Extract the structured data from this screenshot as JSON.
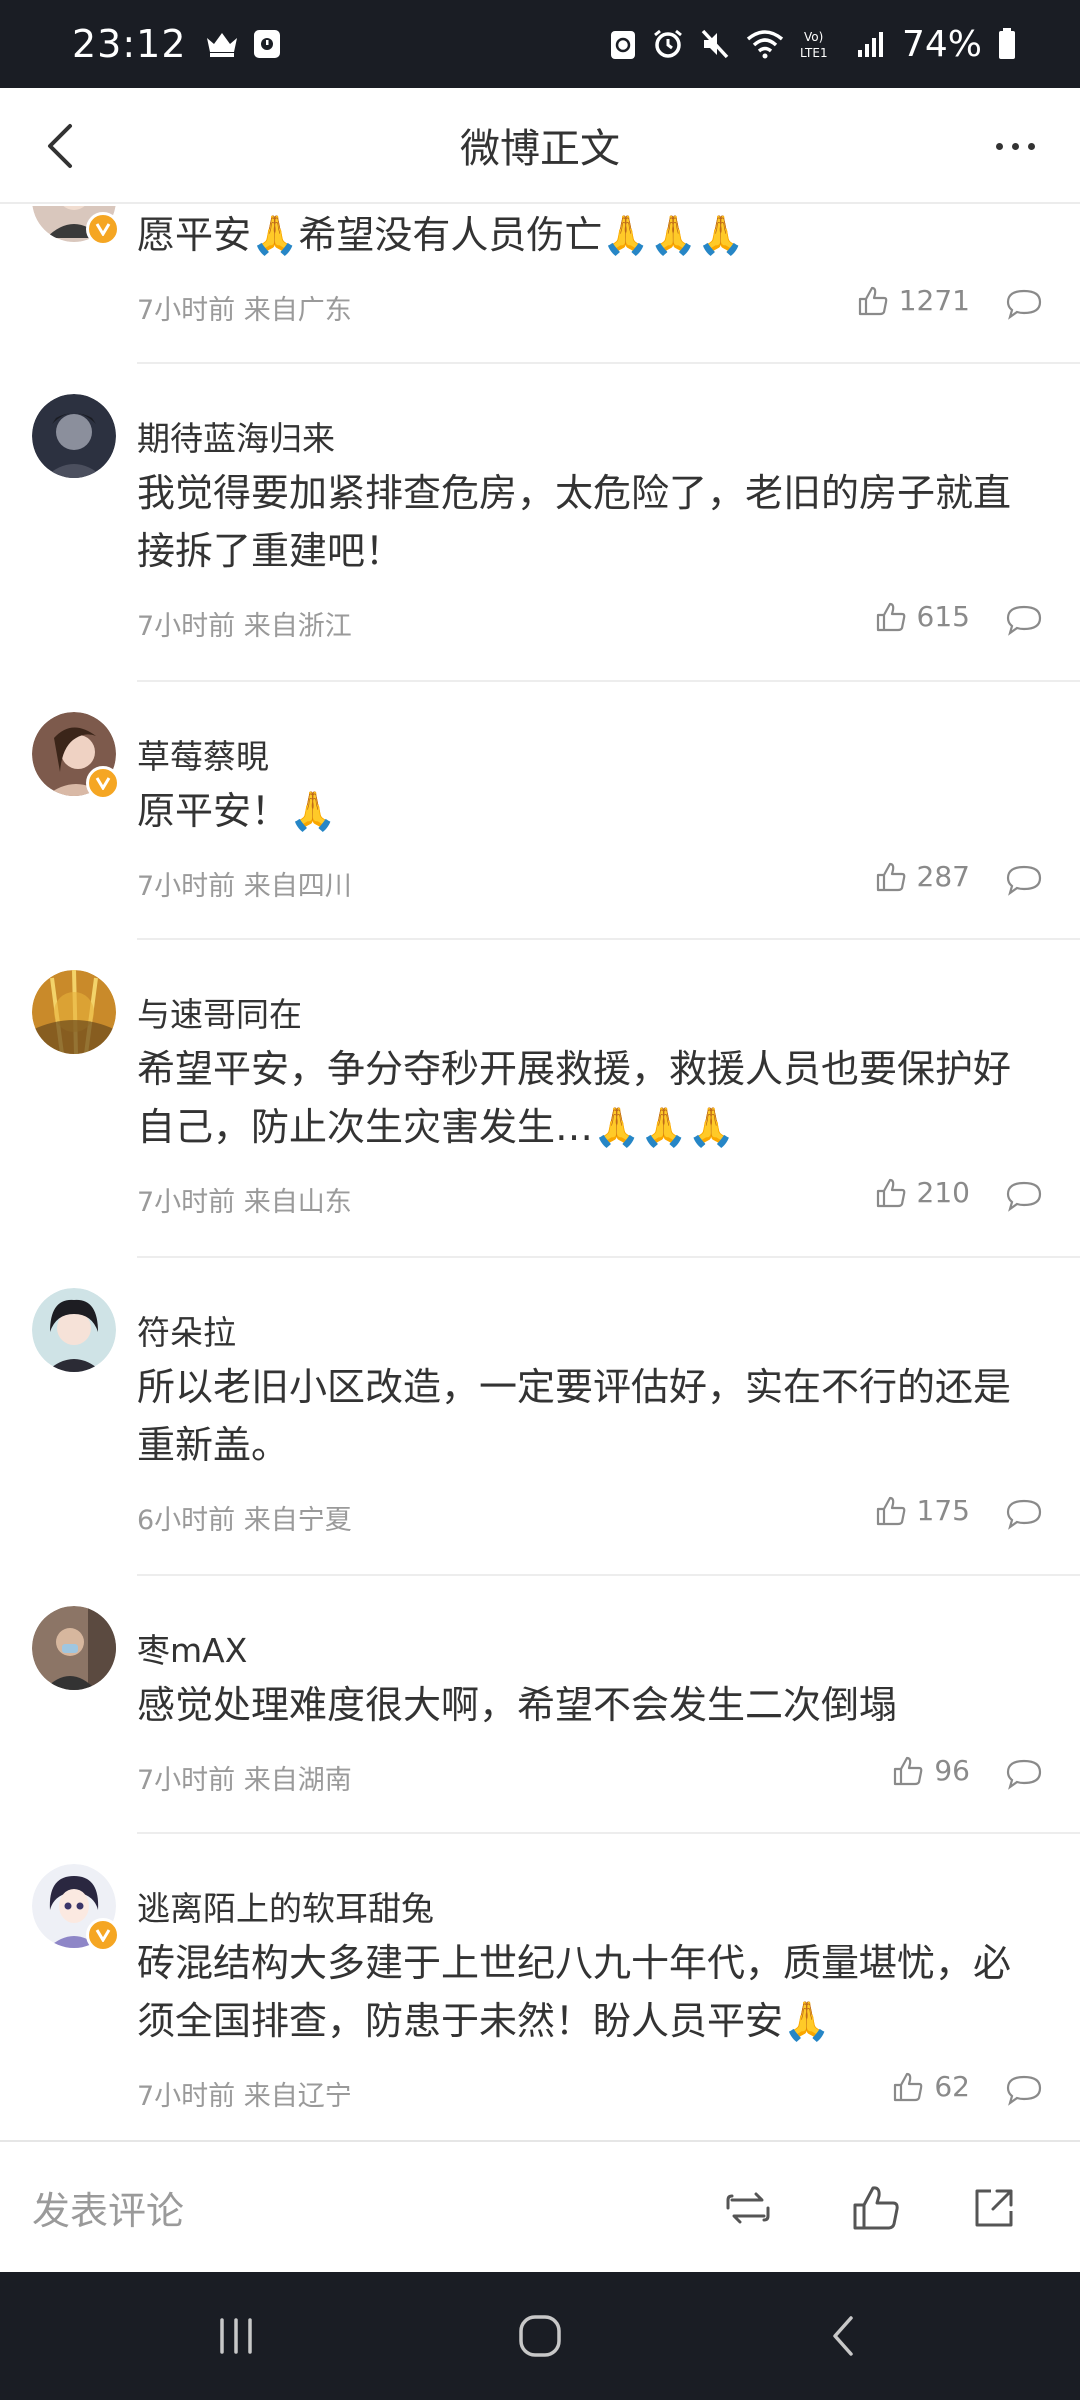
{
  "status_bar": {
    "time": "23:12",
    "battery": "74%"
  },
  "navbar": {
    "title": "微博正文"
  },
  "comments": [
    {
      "username": "",
      "text": "愿平安🙏希望没有人员伤亡🙏🙏🙏",
      "meta": "7小时前 来自广东",
      "likes": "1271",
      "verified": true
    },
    {
      "username": "期待蓝海归来",
      "text": "我觉得要加紧排查危房，太危险了，老旧的房子就直接拆了重建吧！",
      "meta": "7小时前 来自浙江",
      "likes": "615",
      "verified": false
    },
    {
      "username": "草莓蔡晛",
      "text": "原平安！🙏",
      "meta": "7小时前 来自四川",
      "likes": "287",
      "verified": true
    },
    {
      "username": "与速哥同在",
      "text": "希望平安，争分夺秒开展救援，救援人员也要保护好自己，防止次生灾害发生…🙏🙏🙏",
      "meta": "7小时前 来自山东",
      "likes": "210",
      "verified": false
    },
    {
      "username": "符朵拉",
      "text": "所以老旧小区改造，一定要评估好，实在不行的还是重新盖。",
      "meta": "6小时前 来自宁夏",
      "likes": "175",
      "verified": false
    },
    {
      "username": "枣mAX",
      "text": "感觉处理难度很大啊，希望不会发生二次倒塌",
      "meta": "7小时前 来自湖南",
      "likes": "96",
      "verified": false
    },
    {
      "username": "逃离陌上的软耳甜兔",
      "text": "砖混结构大多建于上世纪八九十年代，质量堪忧，必须全国排查，防患于未然！盼人员平安🙏",
      "meta": "7小时前 来自辽宁",
      "likes": "62",
      "verified": true
    }
  ],
  "bottom_bar": {
    "comment_placeholder": "发表评论"
  },
  "colors": {
    "status_bar_bg": "#1a1d24",
    "verified_badge": "#f5a623",
    "meta_text": "#9a9a9a"
  },
  "icons": [
    "crown-icon",
    "media-icon",
    "recycle-icon",
    "alarm-icon",
    "mute-icon",
    "wifi-icon",
    "volte-icon",
    "signal-icon",
    "battery-icon",
    "back-arrow-icon",
    "more-icon",
    "like-icon",
    "reply-icon",
    "repost-icon",
    "share-icon"
  ]
}
